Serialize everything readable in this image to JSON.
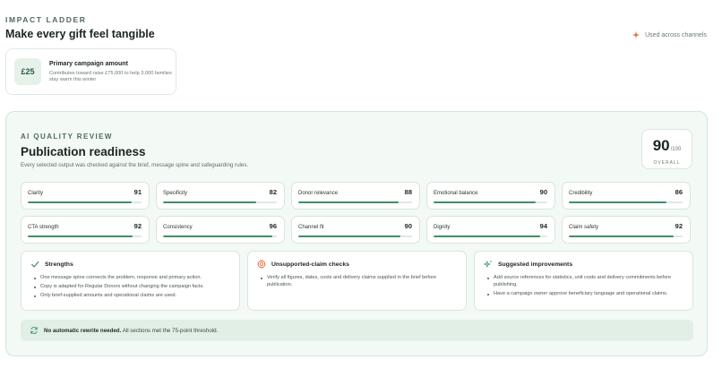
{
  "header": {
    "eyebrow": "IMPACT LADDER",
    "title": "Make every gift feel tangible",
    "used_across": "Used across channels"
  },
  "ladder": {
    "amount": "£25",
    "title": "Primary campaign amount",
    "description": "Contributes toward raise £75,000 to help 3,000 families stay warm this winter"
  },
  "review": {
    "eyebrow": "AI QUALITY REVIEW",
    "title": "Publication readiness",
    "subtitle": "Every selected output was checked against the brief, message spine and safeguarding rules.",
    "overall": {
      "score": "90",
      "out_of": "/100",
      "label": "OVERALL"
    },
    "metrics": [
      {
        "name": "Clarity",
        "value": 91
      },
      {
        "name": "Specificity",
        "value": 82
      },
      {
        "name": "Donor relevance",
        "value": 88
      },
      {
        "name": "Emotional balance",
        "value": 90
      },
      {
        "name": "Credibility",
        "value": 86
      },
      {
        "name": "CTA strength",
        "value": 92
      },
      {
        "name": "Consistency",
        "value": 96
      },
      {
        "name": "Channel fit",
        "value": 90
      },
      {
        "name": "Dignity",
        "value": 94
      },
      {
        "name": "Claim safety",
        "value": 92
      }
    ],
    "panels": {
      "strengths": {
        "title": "Strengths",
        "items": [
          "One message spine connects the problem, response and primary action.",
          "Copy is adapted for Regular Donors without changing the campaign facts.",
          "Only brief-supplied amounts and operational claims are used."
        ]
      },
      "claims": {
        "title": "Unsupported-claim checks",
        "items": [
          "Verify all figures, dates, costs and delivery claims supplied in the brief before publication."
        ]
      },
      "improvements": {
        "title": "Suggested improvements",
        "items": [
          "Add source references for statistics, unit costs and delivery commitments before publishing.",
          "Have a campaign owner approve beneficiary language and operational claims."
        ]
      }
    },
    "banner": {
      "bold": "No automatic rewrite needed.",
      "text": " All sections met the 75-point threshold."
    }
  },
  "colors": {
    "accent": "#3f8f66",
    "panel_bg": "#f3f9f5",
    "sparkle": "#e8643c"
  }
}
